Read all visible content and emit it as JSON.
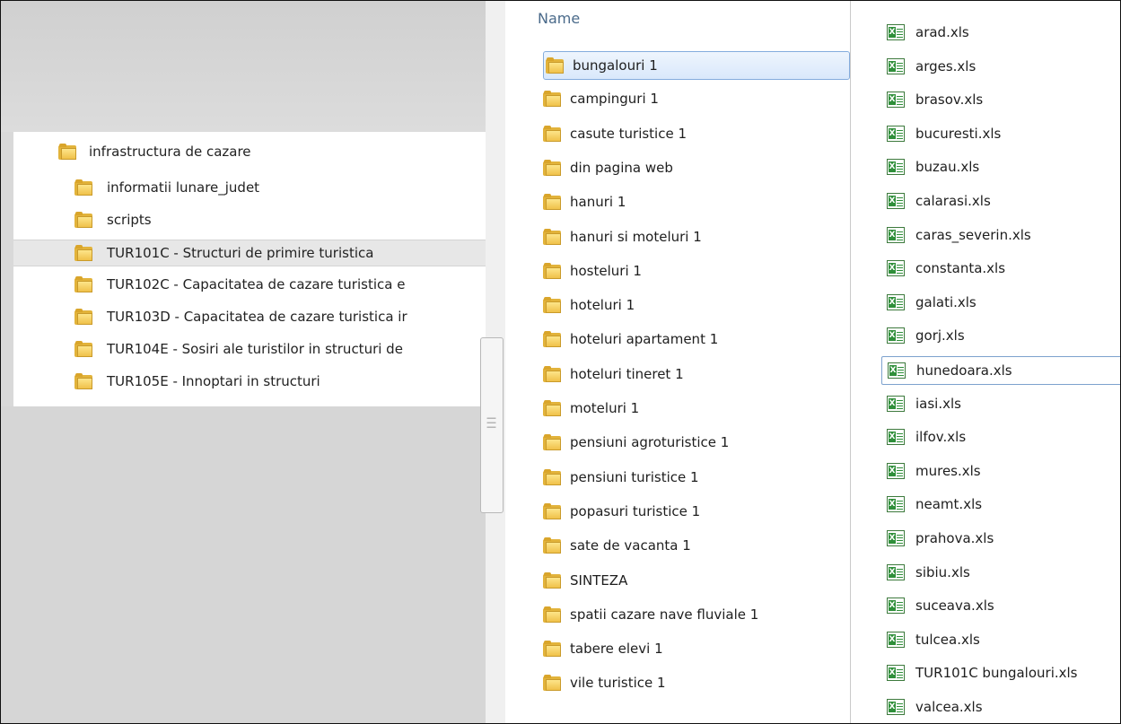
{
  "navigation_pane": {
    "root_folder": "infrastructura de cazare",
    "child_folders": [
      "informatii lunare_judet",
      "scripts",
      "TUR101C - Structuri de primire turistica",
      "TUR102C - Capacitatea de cazare turistica e",
      "TUR103D - Capacitatea de cazare turistica ir",
      "TUR104E - Sosiri ale turistilor in structuri de",
      "TUR105E - Innoptari in structuri"
    ],
    "selected_child": "TUR101C - Structuri de primire turistica"
  },
  "folder_list": {
    "column_header": "Name",
    "items": [
      "bungalouri 1",
      "campinguri 1",
      "casute turistice 1",
      "din pagina web",
      "hanuri 1",
      "hanuri si moteluri 1",
      "hosteluri 1",
      "hoteluri 1",
      "hoteluri apartament 1",
      "hoteluri tineret 1",
      "moteluri 1",
      "pensiuni agroturistice 1",
      "pensiuni turistice 1",
      "popasuri turistice 1",
      "sate de vacanta 1",
      "SINTEZA",
      "spatii cazare nave fluviale 1",
      "tabere elevi 1",
      "vile turistice 1"
    ],
    "selected": "bungalouri 1"
  },
  "file_list": {
    "items": [
      "arad.xls",
      "arges.xls",
      "brasov.xls",
      "bucuresti.xls",
      "buzau.xls",
      "calarasi.xls",
      "caras_severin.xls",
      "constanta.xls",
      "galati.xls",
      "gorj.xls",
      "hunedoara.xls",
      "iasi.xls",
      "ilfov.xls",
      "mures.xls",
      "neamt.xls",
      "prahova.xls",
      "sibiu.xls",
      "suceava.xls",
      "tulcea.xls",
      "TUR101C bungalouri.xls",
      "valcea.xls"
    ],
    "focused": "hunedoara.xls"
  },
  "colors": {
    "folder": "#f0c14a",
    "excel_icon": "#2f8f3a",
    "selection_border": "#84acdd",
    "header_text": "#4a6a8a"
  }
}
